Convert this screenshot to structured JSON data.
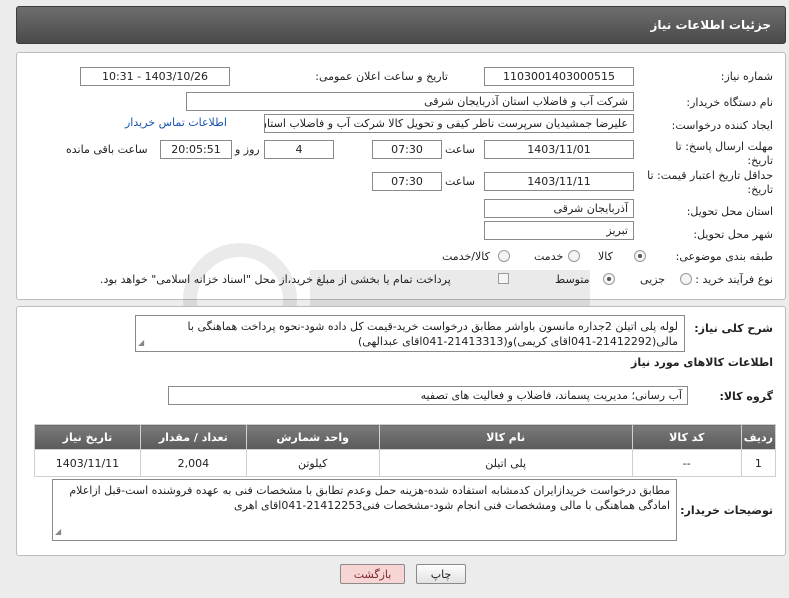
{
  "header": {
    "title": "جزئیات اطلاعات نیاز"
  },
  "form": {
    "need_number": {
      "label": "شماره نیاز:",
      "value": "1103001403000515"
    },
    "announce_datetime": {
      "label": "تاریخ و ساعت اعلان عمومی:",
      "value": "1403/10/26 - 10:31"
    },
    "buyer_org": {
      "label": "نام دستگاه خریدار:",
      "value": "شرکت آب و فاضلاب استان آذربایجان شرقی"
    },
    "creator": {
      "label": "ایجاد کننده درخواست:",
      "value": "علیرضا جمشیدیان سرپرست ناظر کیفی و تحویل کالا شرکت آب و فاضلاب استان",
      "link": "اطلاعات تماس خریدار"
    },
    "reply_deadline": {
      "label_line1": "مهلت ارسال پاسخ: تا",
      "label_line2": "تاریخ:",
      "date": "1403/11/01",
      "time_label": "ساعت",
      "time": "07:30",
      "days": "4",
      "days_label": "روز و",
      "remaining": "20:05:51",
      "remaining_label": "ساعت باقی مانده"
    },
    "price_validity": {
      "label_line1": "حداقل تاریخ اعتبار قیمت: تا",
      "label_line2": "تاریخ:",
      "date": "1403/11/11",
      "time_label": "ساعت",
      "time": "07:30"
    },
    "delivery_province": {
      "label": "استان محل تحویل:",
      "value": "آذربایجان شرقی"
    },
    "delivery_city": {
      "label": "شهر محل تحویل:",
      "value": "تبریز"
    },
    "category": {
      "label": "طبقه بندی موضوعی:",
      "options": [
        "کالا",
        "خدمت",
        "کالا/خدمت"
      ],
      "selected": "کالا"
    },
    "process_type": {
      "label": "نوع فرآیند خرید :",
      "options": [
        "جزیی",
        "متوسط"
      ],
      "selected": "متوسط",
      "payment_note": "پرداخت تمام یا بخشی از مبلغ خرید،از محل \"اسناد خزانه اسلامی\" خواهد بود."
    }
  },
  "description": {
    "label": "شرح کلی نیاز:",
    "text": "لوله پلی اتیلن 2جداره مانسون باواشر مطابق درخواست خرید-قیمت کل داده شود-نحوه پرداخت هماهنگی با مالی(21412292-041اقای کریمی)و(21413313-041اقای عبدالهی)"
  },
  "goods_info": {
    "title": "اطلاعات کالاهای مورد نیاز",
    "group_label": "گروه کالا:",
    "group_value": "آب رسانی؛ مدیریت پسماند، فاضلاب و فعالیت های تصفیه"
  },
  "table": {
    "headers": [
      "ردیف",
      "کد کالا",
      "نام کالا",
      "واحد شمارش",
      "تعداد / مقدار",
      "تاریخ نیاز"
    ],
    "rows": [
      [
        "1",
        "--",
        "پلی اتیلن",
        "کیلوتن",
        "2,004",
        "1403/11/11"
      ]
    ]
  },
  "buyer_notes": {
    "label": "توضیحات خریدار:",
    "text": "مطابق درخواست خریدازایران کدمشابه استفاده شده-هزینه حمل وعدم تطابق با مشخصات فنی به عهده فروشنده است-قبل ازاعلام امادگی هماهنگی با مالی ومشخصات فنی انجام شود-مشخصات فنی21412253-041اقای اهری"
  },
  "buttons": {
    "print": "چاپ",
    "back": "بازگشت"
  },
  "colors": {
    "header_bg": "#5a5a5a",
    "link": "#1a53b0",
    "back_button_bg": "#f7d5d5"
  }
}
